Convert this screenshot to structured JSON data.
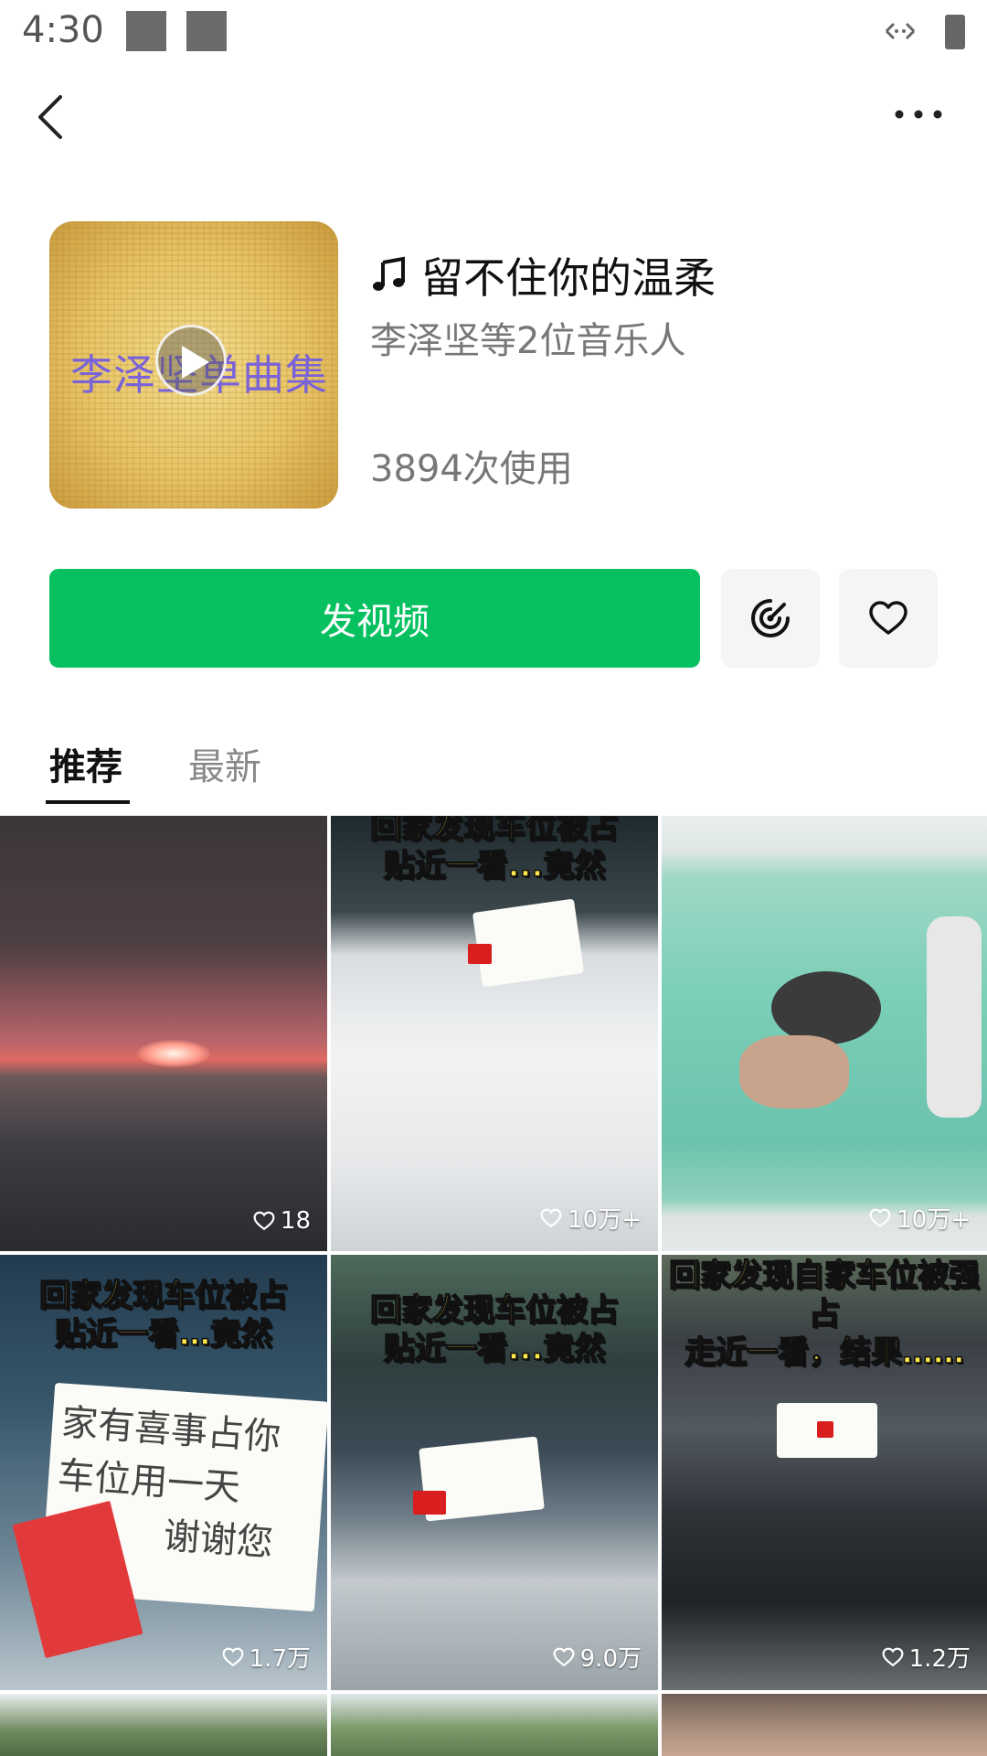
{
  "status_bar": {
    "time": "4:30"
  },
  "header": {
    "back_icon": "chevron-left-icon",
    "more_icon": "more-dots-icon"
  },
  "music": {
    "cover_text": "李泽坚单曲集",
    "title": "留不住你的温柔",
    "title_icon": "music-note-icon",
    "artists": "李泽坚等2位音乐人",
    "uses": "3894次使用"
  },
  "actions": {
    "post_label": "发视频",
    "radar_icon": "radar-icon",
    "favorite_icon": "heart-icon",
    "accent": "#07c160"
  },
  "tabs": [
    {
      "label": "推荐",
      "active": true
    },
    {
      "label": "最新",
      "active": false
    }
  ],
  "videos": [
    {
      "likes": "18",
      "caption": ""
    },
    {
      "likes": "10万+",
      "caption": "回家发现车位被占\n贴近一看...竟然"
    },
    {
      "likes": "10万+",
      "caption": ""
    },
    {
      "likes": "1.7万",
      "caption": "回家发现车位被占\n贴近一看…竟然"
    },
    {
      "likes": "9.0万",
      "caption": "回家发现车位被占\n贴近一看...竟然"
    },
    {
      "likes": "1.2万",
      "caption": "回家发现自家车位被强占\n走近一看，结果……"
    }
  ],
  "note_texts": {
    "tile4_line1": "家有喜事占你",
    "tile4_line2": "车位用一天",
    "tile4_line3": "谢谢您"
  }
}
